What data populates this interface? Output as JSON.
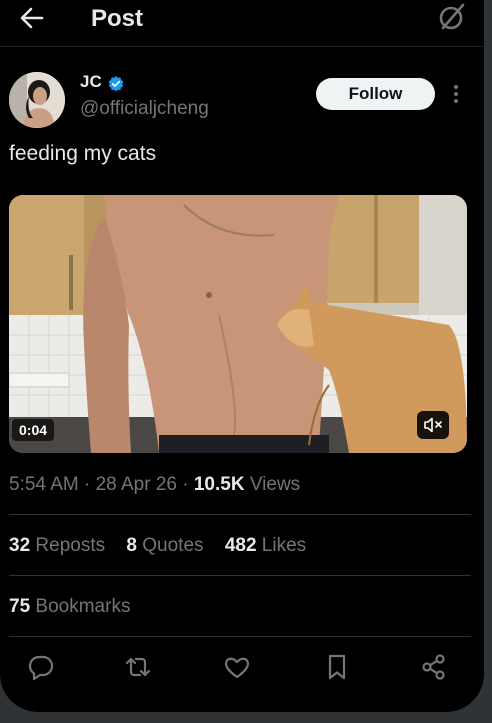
{
  "header": {
    "title": "Post",
    "back_icon": "arrow-left-icon",
    "grok_icon": "grok-icon"
  },
  "author": {
    "name": "JC",
    "handle": "@officialjcheng",
    "verified": true,
    "verified_color": "#1d9bf0",
    "follow_label": "Follow"
  },
  "post": {
    "text": "feeding my cats",
    "video": {
      "duration": "0:04",
      "muted": true
    },
    "time": "5:54 AM",
    "date": "28 Apr 26",
    "views_count": "10.5K",
    "views_label": "Views"
  },
  "stats": {
    "reposts_count": "32",
    "reposts_label": "Reposts",
    "quotes_count": "8",
    "quotes_label": "Quotes",
    "likes_count": "482",
    "likes_label": "Likes",
    "bookmarks_count": "75",
    "bookmarks_label": "Bookmarks"
  },
  "actions": [
    "reply-icon",
    "repost-icon",
    "like-icon",
    "bookmark-icon",
    "share-icon"
  ],
  "colors": {
    "background": "#000000",
    "text_primary": "#e7e9ea",
    "text_secondary": "#71767b",
    "accent": "#1d9bf0",
    "follow_bg": "#eff3f4"
  }
}
